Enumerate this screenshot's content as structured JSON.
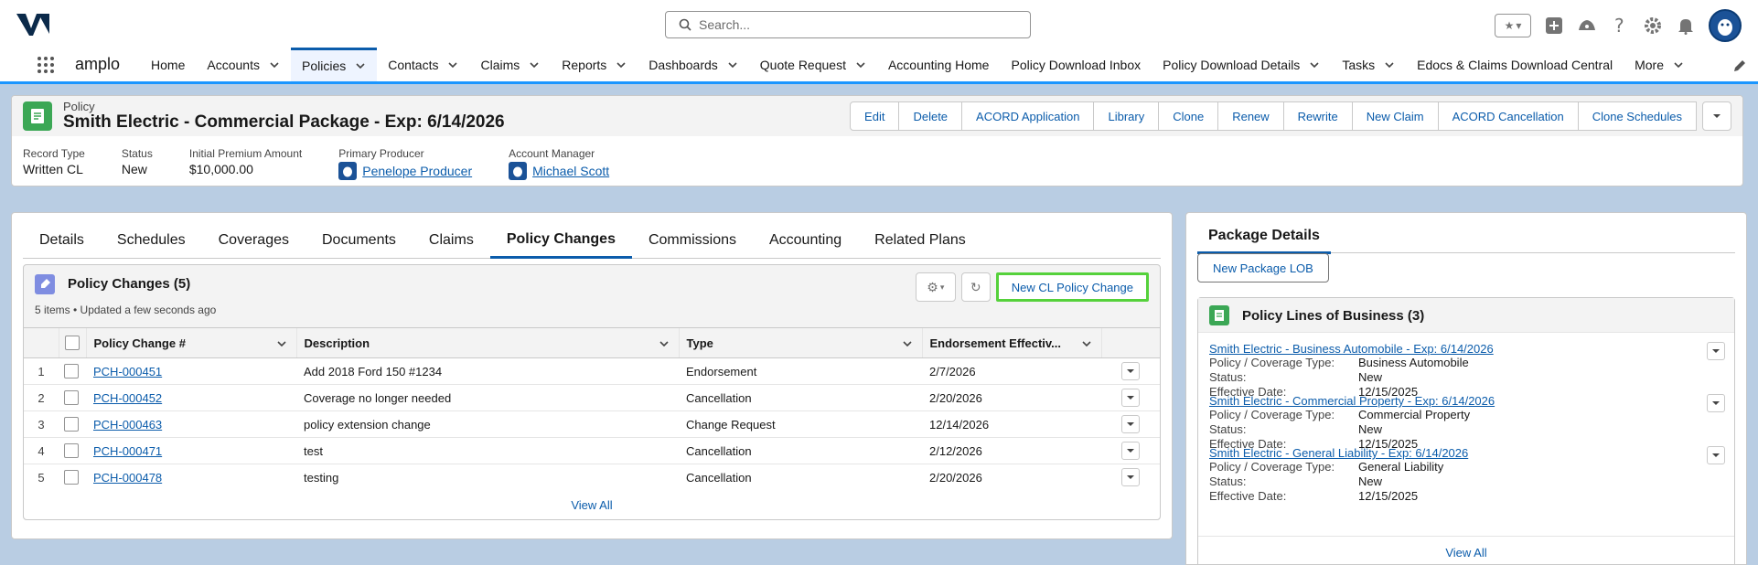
{
  "header": {
    "search_placeholder": "Search..."
  },
  "nav": {
    "app_name": "amplo",
    "items": [
      {
        "label": "Home",
        "menu": false,
        "active": false
      },
      {
        "label": "Accounts",
        "menu": true,
        "active": false
      },
      {
        "label": "Policies",
        "menu": true,
        "active": true
      },
      {
        "label": "Contacts",
        "menu": true,
        "active": false
      },
      {
        "label": "Claims",
        "menu": true,
        "active": false
      },
      {
        "label": "Reports",
        "menu": true,
        "active": false
      },
      {
        "label": "Dashboards",
        "menu": true,
        "active": false
      },
      {
        "label": "Quote Request",
        "menu": true,
        "active": false
      },
      {
        "label": "Accounting Home",
        "menu": false,
        "active": false
      },
      {
        "label": "Policy Download Inbox",
        "menu": false,
        "active": false
      },
      {
        "label": "Policy Download Details",
        "menu": true,
        "active": false
      },
      {
        "label": "Tasks",
        "menu": true,
        "active": false
      },
      {
        "label": "Edocs & Claims Download Central",
        "menu": false,
        "active": false
      },
      {
        "label": "More",
        "menu": true,
        "active": false
      }
    ]
  },
  "record": {
    "object_label": "Policy",
    "title": "Smith Electric - Commercial Package - Exp: 6/14/2026",
    "actions": [
      "Edit",
      "Delete",
      "ACORD Application",
      "Library",
      "Clone",
      "Renew",
      "Rewrite",
      "New Claim",
      "ACORD Cancellation",
      "Clone Schedules"
    ],
    "fields": [
      {
        "label": "Record Type",
        "value": "Written CL"
      },
      {
        "label": "Status",
        "value": "New"
      },
      {
        "label": "Initial Premium Amount",
        "value": "$10,000.00"
      },
      {
        "label": "Primary Producer",
        "value": "Penelope Producer"
      },
      {
        "label": "Account Manager",
        "value": "Michael Scott"
      }
    ]
  },
  "tabs": [
    "Details",
    "Schedules",
    "Coverages",
    "Documents",
    "Claims",
    "Policy Changes",
    "Commissions",
    "Accounting",
    "Related Plans"
  ],
  "active_tab": "Policy Changes",
  "related_list": {
    "title": "Policy Changes (5)",
    "subtitle": "5 items • Updated a few seconds ago",
    "new_button": "New CL Policy Change",
    "columns": [
      "Policy Change #",
      "Description",
      "Type",
      "Endorsement Effectiv..."
    ],
    "rows": [
      {
        "n": "1",
        "id": "PCH-000451",
        "desc": "Add 2018 Ford 150 #1234",
        "type": "Endorsement",
        "date": "2/7/2026"
      },
      {
        "n": "2",
        "id": "PCH-000452",
        "desc": "Coverage no longer needed",
        "type": "Cancellation",
        "date": "2/20/2026"
      },
      {
        "n": "3",
        "id": "PCH-000463",
        "desc": "policy extension change",
        "type": "Change Request",
        "date": "12/14/2026"
      },
      {
        "n": "4",
        "id": "PCH-000471",
        "desc": "test",
        "type": "Cancellation",
        "date": "2/12/2026"
      },
      {
        "n": "5",
        "id": "PCH-000478",
        "desc": "testing",
        "type": "Cancellation",
        "date": "2/20/2026"
      }
    ],
    "view_all": "View All"
  },
  "package": {
    "tab_label": "Package Details",
    "new_button": "New Package LOB",
    "lob_title": "Policy Lines of Business (3)",
    "items": [
      {
        "title": "Smith Electric - Business Automobile - Exp: 6/14/2026",
        "rows": [
          [
            "Policy / Coverage Type:",
            "Business Automobile"
          ],
          [
            "Status:",
            "New"
          ],
          [
            "Effective Date:",
            "12/15/2025"
          ]
        ]
      },
      {
        "title": "Smith Electric - Commercial Property - Exp: 6/14/2026",
        "rows": [
          [
            "Policy / Coverage Type:",
            "Commercial Property"
          ],
          [
            "Status:",
            "New"
          ],
          [
            "Effective Date:",
            "12/15/2025"
          ]
        ]
      },
      {
        "title": "Smith Electric - General Liability - Exp: 6/14/2026",
        "rows": [
          [
            "Policy / Coverage Type:",
            "General Liability"
          ],
          [
            "Status:",
            "New"
          ],
          [
            "Effective Date:",
            "12/15/2025"
          ]
        ]
      }
    ],
    "view_all": "View All"
  }
}
